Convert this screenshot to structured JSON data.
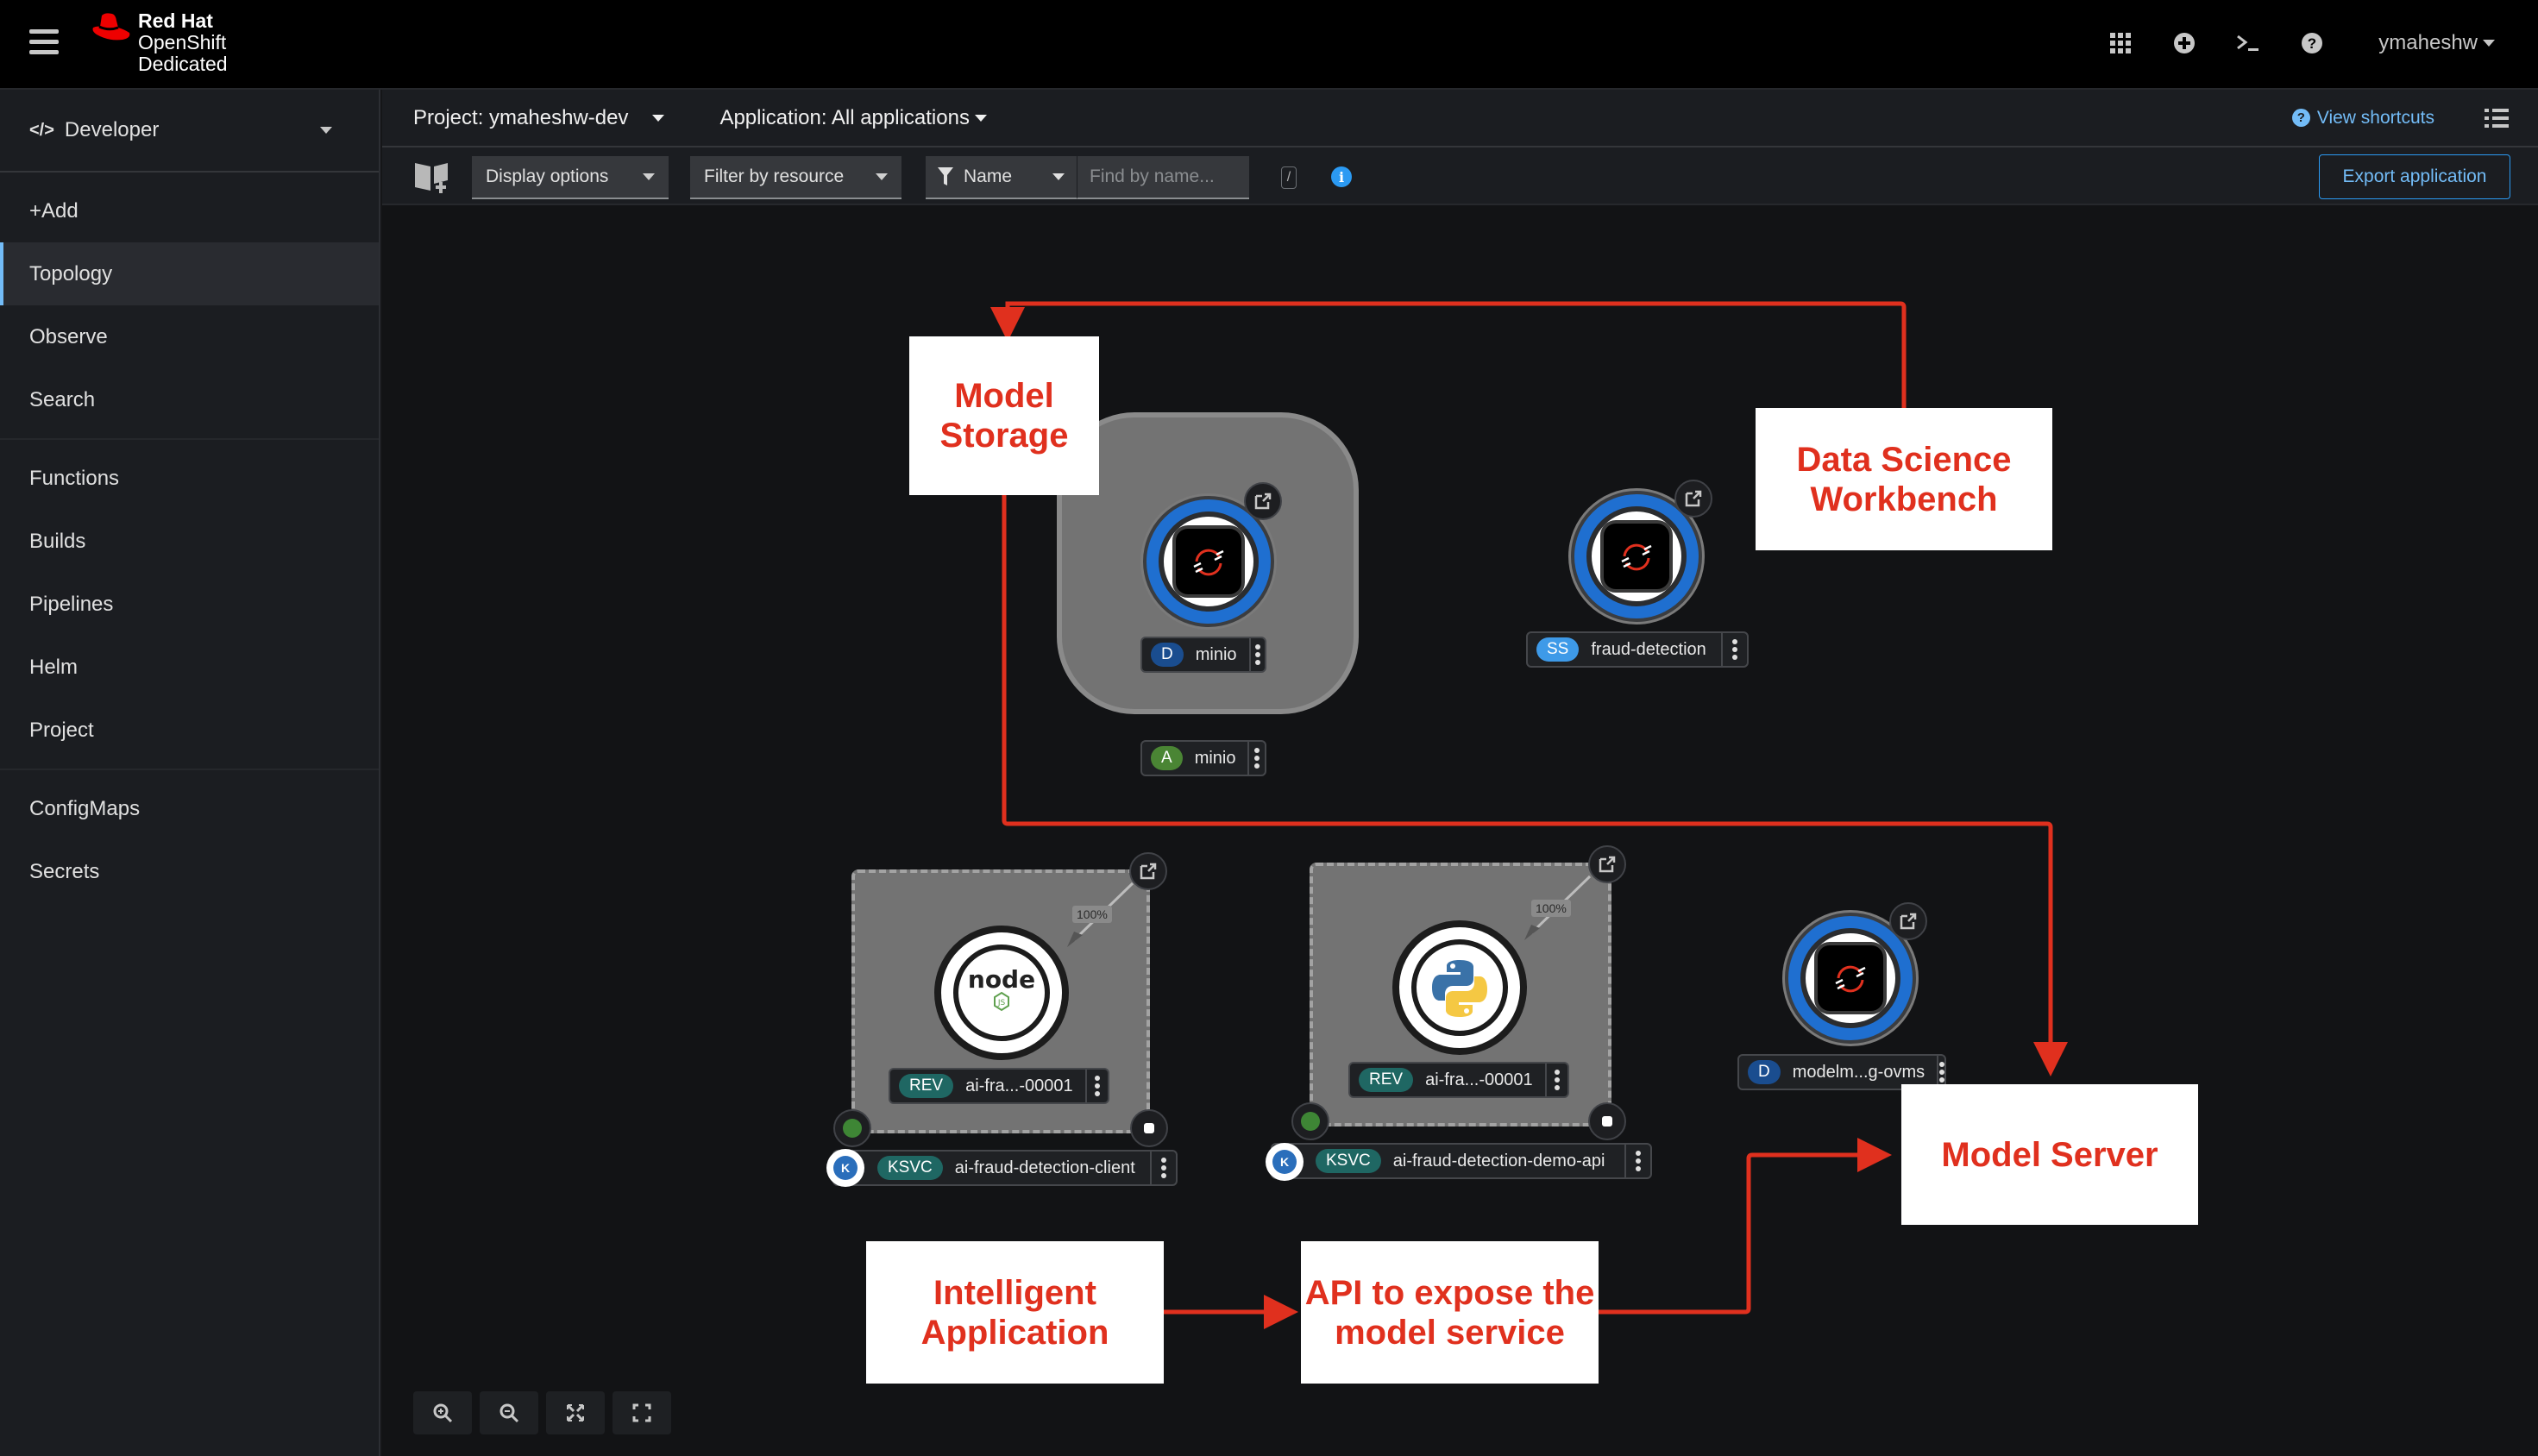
{
  "masthead": {
    "brand_line1": "Red Hat",
    "brand_line2": "OpenShift",
    "brand_line3": "Dedicated",
    "icons": [
      "app-launcher-icon",
      "plus-circle-icon",
      "terminal-icon",
      "help-icon"
    ],
    "user": "ymaheshw"
  },
  "sidebar": {
    "perspective": "Developer",
    "groups": [
      [
        {
          "label": "+Add"
        },
        {
          "label": "Topology",
          "active": true
        },
        {
          "label": "Observe"
        },
        {
          "label": "Search"
        }
      ],
      [
        {
          "label": "Functions"
        },
        {
          "label": "Builds"
        },
        {
          "label": "Pipelines"
        },
        {
          "label": "Helm"
        },
        {
          "label": "Project"
        }
      ],
      [
        {
          "label": "ConfigMaps"
        },
        {
          "label": "Secrets"
        }
      ]
    ]
  },
  "projectbar": {
    "project": "Project: ymaheshw-dev",
    "application": "Application: All applications",
    "view_shortcuts": "View shortcuts"
  },
  "toolbar": {
    "display_options": "Display options",
    "filter_by_resource": "Filter by resource",
    "filter_type": "Name",
    "find_placeholder": "Find by name...",
    "find_value": "",
    "shortcut_key": "/",
    "export": "Export application"
  },
  "topology": {
    "nodes": {
      "minio_deployment": {
        "badge": "D",
        "name": "minio"
      },
      "minio_app": {
        "badge": "A",
        "name": "minio"
      },
      "fraud_detection": {
        "badge": "SS",
        "name": "fraud-detection"
      },
      "client_rev": {
        "badge": "REV",
        "name": "ai-fra...-00001",
        "traffic": "100%"
      },
      "client_ksvc": {
        "badge": "KSVC",
        "name": "ai-fraud-detection-client"
      },
      "api_rev": {
        "badge": "REV",
        "name": "ai-fra...-00001",
        "traffic": "100%"
      },
      "api_ksvc": {
        "badge": "KSVC",
        "name": "ai-fraud-detection-demo-api"
      },
      "model_server": {
        "badge": "D",
        "name": "modelm...g-ovms"
      }
    },
    "annotations": {
      "model_storage": "Model Storage",
      "data_science_workbench": "Data Science Workbench",
      "model_server": "Model Server",
      "intelligent_application": "Intelligent Application",
      "api_expose": "API to expose the model service"
    },
    "colors": {
      "annotation_red": "#e0301e",
      "pod_ring_blue": "#1f6fd0",
      "link_blue": "#73bcf7"
    }
  },
  "zoom_controls": [
    "zoom-in",
    "zoom-out",
    "fit-to-screen",
    "reset-view"
  ]
}
